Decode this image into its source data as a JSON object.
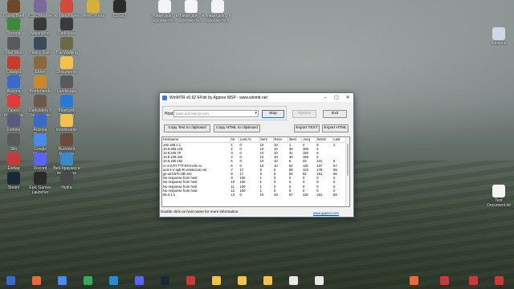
{
  "desktop": {
    "icons": [
      {
        "label": "Grand Theft Auto IV",
        "color": "#6a4a2a"
      },
      {
        "label": "ICSC Modder",
        "color": "#7a6a9a"
      },
      {
        "label": "Roblox Player",
        "color": "#d44a3a"
      },
      {
        "label": "WinMTR.exe",
        "color": "#d4b23a"
      },
      {
        "label": "CS:GO",
        "color": "#2a2a2a"
      },
      {
        "label": "Новый док... в документе...",
        "color": "#f4f4f4"
      },
      {
        "label": "Новый док... в документе...",
        "color": "#f4f4f4"
      },
      {
        "label": "Новый док... в документе...",
        "color": "#f4f4f4"
      },
      {
        "label": "Terraria",
        "color": "#3a8a3a"
      },
      {
        "label": "MelonMod",
        "color": "#3a3a3a"
      },
      {
        "label": "DarkNova",
        "color": "#3a3a3a"
      },
      {
        "label": "Mad Max",
        "color": "#5a5a5a"
      },
      {
        "label": "Heavy Rain",
        "color": "#3a4a5a"
      },
      {
        "label": "The Walking Dead",
        "color": "#6a6a4a"
      },
      {
        "label": "Catalyst Control",
        "color": "#c83a2a"
      },
      {
        "label": "Elden",
        "color": "#8a6a3a"
      },
      {
        "label": "Documents",
        "color": "#f2c14e"
      },
      {
        "label": "Arizona Games",
        "color": "#3a6ac8"
      },
      {
        "label": "Borderlands",
        "color": "#c88a2a"
      },
      {
        "label": "Landscape",
        "color": "#5a5a5a"
      },
      {
        "label": "Opera Passwords",
        "color": "#e03a3a"
      },
      {
        "label": "Darksiders II Deathinitive",
        "color": "#6a5a4a"
      },
      {
        "label": "Bluetooth Tweaker",
        "color": "#2a7ad4"
      },
      {
        "label": "Fortnite",
        "color": "#5a5a7a"
      },
      {
        "label": "Arizona Games Launcher",
        "color": "#3a6ac8"
      },
      {
        "label": "moonloader",
        "color": "#f2c14e"
      },
      {
        "label": "Sifu",
        "color": "#5a5a5a"
      },
      {
        "label": "Google Chrome",
        "color": "#4a8ae8"
      },
      {
        "label": "Buckshot Roulette",
        "color": "#6a4a3a"
      },
      {
        "label": "Exitlag",
        "color": "#c83a3a"
      },
      {
        "label": "Discord",
        "color": "#5865f2"
      },
      {
        "label": "Веб-браузер в песочнице",
        "color": "#3a8ac8"
      },
      {
        "label": "Steam",
        "color": "#1b2838"
      },
      {
        "label": "Epic Games Launcher",
        "color": "#2a2a2a"
      },
      {
        "label": "Hydra",
        "color": "#4a4a4a"
      },
      {
        "label": "Корзина",
        "color": "#cfd8e6"
      },
      {
        "label": "Text Document.txt",
        "color": "#f4f4f4"
      }
    ]
  },
  "window": {
    "title": "WinMTR v0.92 64 bit by Appnor MSP - www.winmtr.net",
    "host_label": "Host:",
    "host_value": "pass.arizona-rp.com",
    "buttons": {
      "stop": "Stop",
      "options": "Options",
      "exit": "Exit",
      "copy_text": "Copy Text to clipboard",
      "copy_html": "Copy HTML to clipboard",
      "export_text": "Export TEXT",
      "export_html": "Export HTML"
    },
    "table": {
      "headers": [
        "Hostname",
        "Nr",
        "Loss %",
        "Sent",
        "Recv",
        "Best",
        "Avrg",
        "Worst",
        "Last"
      ],
      "rows": [
        [
          "192.168.1.1",
          "1",
          "0",
          "10",
          "10",
          "1",
          "4",
          "8",
          "2"
        ],
        [
          "10.8.255.125",
          "2",
          "0",
          "10",
          "10",
          "30",
          "169",
          "4",
          ""
        ],
        [
          "10.8.245.70",
          "3",
          "0",
          "10",
          "10",
          "31",
          "190",
          "6",
          ""
        ],
        [
          "10.8.249.222",
          "4",
          "0",
          "10",
          "10",
          "30",
          "169",
          "5",
          ""
        ],
        [
          "10.8.250.152",
          "5",
          "0",
          "10",
          "10",
          "6",
          "33",
          "101",
          "6"
        ],
        [
          "cr-4-0.RT.TTT.RCV.ertn.ru",
          "6",
          "0",
          "10",
          "10",
          "52",
          "115",
          "107",
          "57"
        ],
        [
          "ae3-4.rr.spb.RI.ertelecom.net",
          "7",
          "17",
          "6",
          "5",
          "58",
          "123",
          "176",
          "58"
        ],
        [
          "ge-azG570.vtth.net",
          "8",
          "17",
          "6",
          "5",
          "55",
          "92",
          "151",
          "55"
        ],
        [
          "No response from host",
          "9",
          "100",
          "1",
          "0",
          "0",
          "0",
          "0",
          "0"
        ],
        [
          "No response from host",
          "10",
          "100",
          "1",
          "0",
          "0",
          "0",
          "0",
          "0"
        ],
        [
          "No response from host",
          "11",
          "100",
          "1",
          "0",
          "0",
          "0",
          "0",
          "0"
        ],
        [
          "No response from host",
          "12",
          "100",
          "1",
          "0",
          "0",
          "0",
          "0",
          "0"
        ],
        [
          "85.4.1.1",
          "13",
          "0",
          "10",
          "10",
          "57",
          "119",
          "161",
          "59"
        ]
      ]
    },
    "status_text": "Double click on host name for more information.",
    "footer_link": "www.appnor.com"
  }
}
